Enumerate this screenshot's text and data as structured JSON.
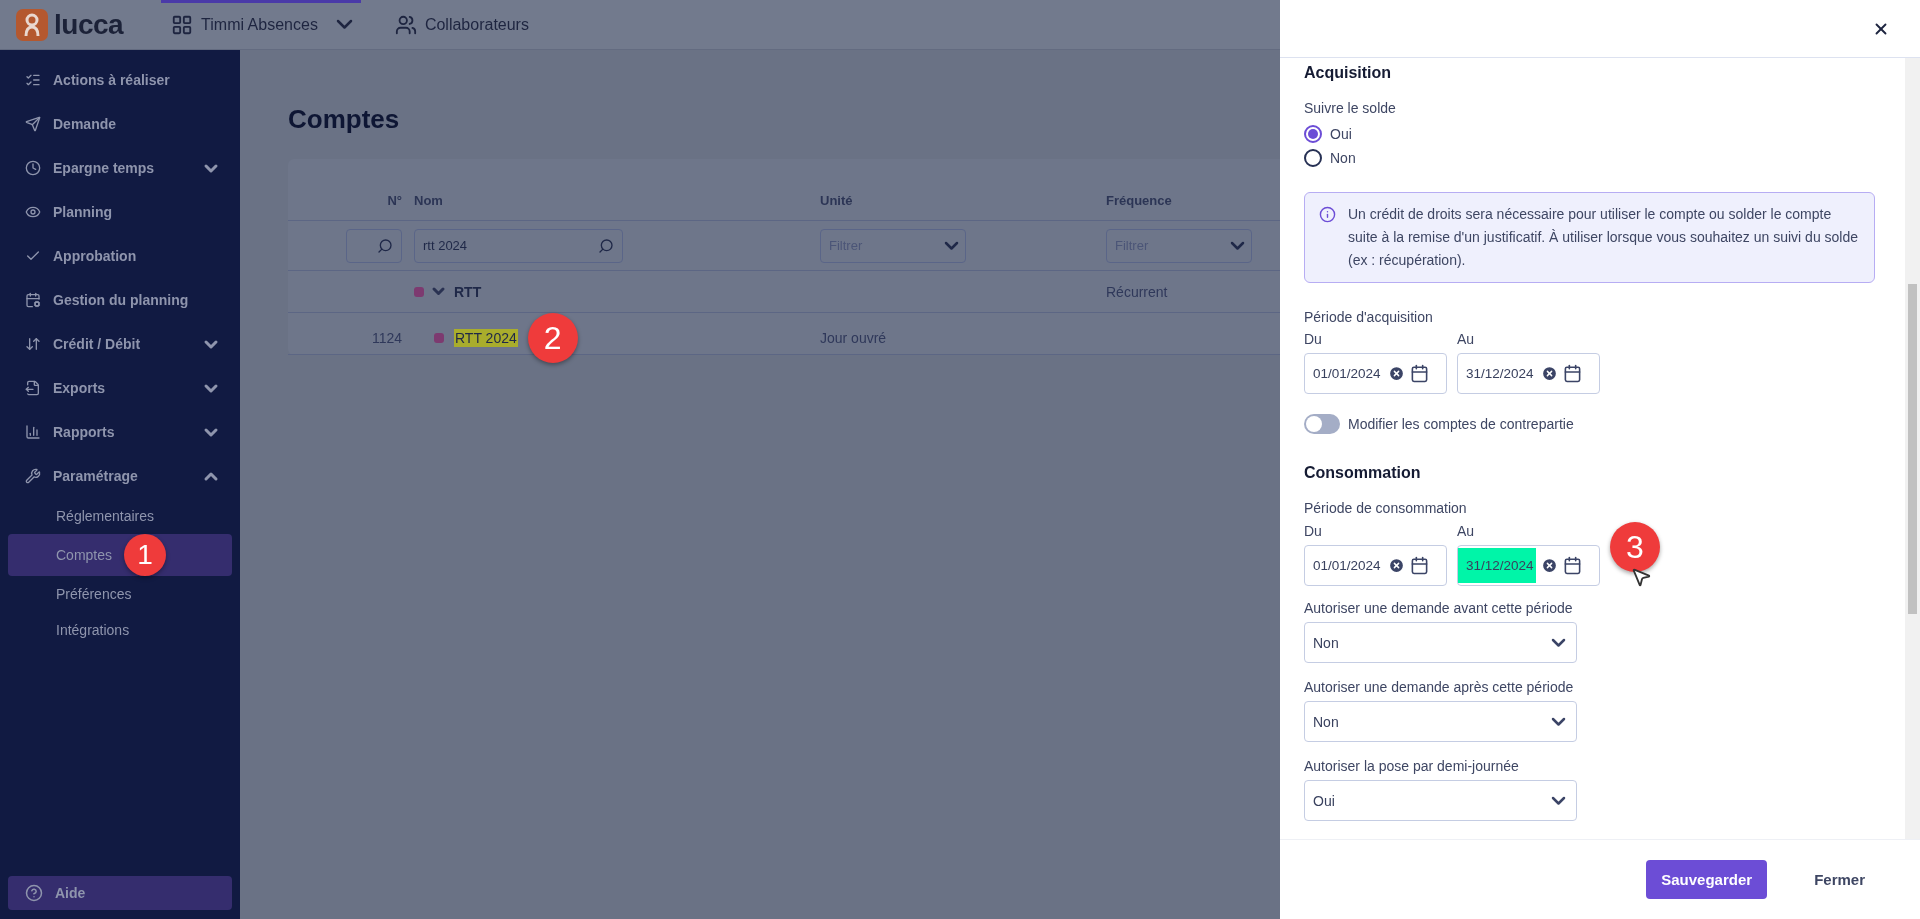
{
  "top_bar": {
    "logo": "lucca",
    "nav": [
      {
        "label": "Timmi Absences",
        "selected": true,
        "has_menu": true
      },
      {
        "label": "Collaborateurs",
        "selected": false,
        "has_menu": false
      }
    ]
  },
  "sidebar": {
    "items": [
      {
        "label": "Actions à réaliser",
        "selected": false
      },
      {
        "label": "Demande",
        "selected": false
      },
      {
        "label": "Epargne temps",
        "selected": false,
        "expanded": false
      },
      {
        "label": "Planning",
        "selected": false
      },
      {
        "label": "Approbation",
        "selected": false
      },
      {
        "label": "Gestion du planning",
        "selected": false
      },
      {
        "label": "Crédit / Débit",
        "selected": false,
        "expanded": false
      },
      {
        "label": "Exports",
        "selected": false,
        "expanded": false
      },
      {
        "label": "Rapports",
        "selected": false,
        "expanded": false
      },
      {
        "label": "Paramétrage",
        "selected": false,
        "expanded": true,
        "children": [
          {
            "label": "Réglementaires",
            "selected": false
          },
          {
            "label": "Comptes",
            "selected": true,
            "badge": "1"
          },
          {
            "label": "Préférences",
            "selected": false
          },
          {
            "label": "Intégrations",
            "selected": false
          }
        ]
      }
    ],
    "help": {
      "label": "Aide"
    }
  },
  "page": {
    "title": "Comptes",
    "table": {
      "columns": [
        "N°",
        "Nom",
        "Unité",
        "Fréquence"
      ],
      "filters": [
        {
          "kind": "search"
        },
        {
          "kind": "search",
          "value": "rtt 2024"
        },
        {
          "kind": "select",
          "placeholder": "Filtrer"
        },
        {
          "kind": "select",
          "placeholder": "Filtrer"
        }
      ],
      "rows": [
        {
          "name": "RTT",
          "frequency": "Récurrent",
          "color": "#7d3a70",
          "expanded": true,
          "children": [
            {
              "number": "1124",
              "name": "RTT 2024",
              "unit": "Jour ouvré",
              "color": "#7d3a70",
              "highlighted": true,
              "badge": "2"
            }
          ]
        }
      ]
    }
  },
  "drawer": {
    "sections": [
      {
        "title": "Acquisition",
        "fields": [
          {
            "kind": "radio",
            "label": "Suivre le solde",
            "options": [
              {
                "label": "Oui",
                "selected": true
              },
              {
                "label": "Non",
                "selected": false
              }
            ]
          },
          {
            "kind": "info",
            "text": "Un crédit de droits sera nécessaire pour utiliser le compte ou solder le compte suite à la remise d'un justificatif. À utiliser lorsque vous souhaitez un suivi du solde (ex : récupération)."
          },
          {
            "kind": "date_range",
            "label": "Période d'acquisition",
            "from": {
              "label": "Du",
              "value": "01/01/2024",
              "highlighted": false
            },
            "to": {
              "label": "Au",
              "value": "31/12/2024",
              "highlighted": false
            }
          },
          {
            "kind": "toggle",
            "label": "Modifier les comptes de contrepartie",
            "on": false
          }
        ]
      },
      {
        "title": "Consommation",
        "fields": [
          {
            "kind": "date_range",
            "label": "Période de consommation",
            "from": {
              "label": "Du",
              "value": "01/01/2024",
              "highlighted": false
            },
            "to": {
              "label": "Au",
              "value": "31/12/2024",
              "highlighted": true,
              "badge": "3"
            }
          },
          {
            "kind": "select",
            "label": "Autoriser une demande avant cette période",
            "value": "Non"
          },
          {
            "kind": "select",
            "label": "Autoriser une demande après cette période",
            "value": "Non"
          },
          {
            "kind": "select",
            "label": "Autoriser la pose par demi-journée",
            "value": "Oui"
          }
        ]
      }
    ],
    "buttons": [
      {
        "label": "Sauvegarder",
        "kind": "primary"
      },
      {
        "label": "Fermer",
        "kind": "secondary"
      }
    ]
  }
}
